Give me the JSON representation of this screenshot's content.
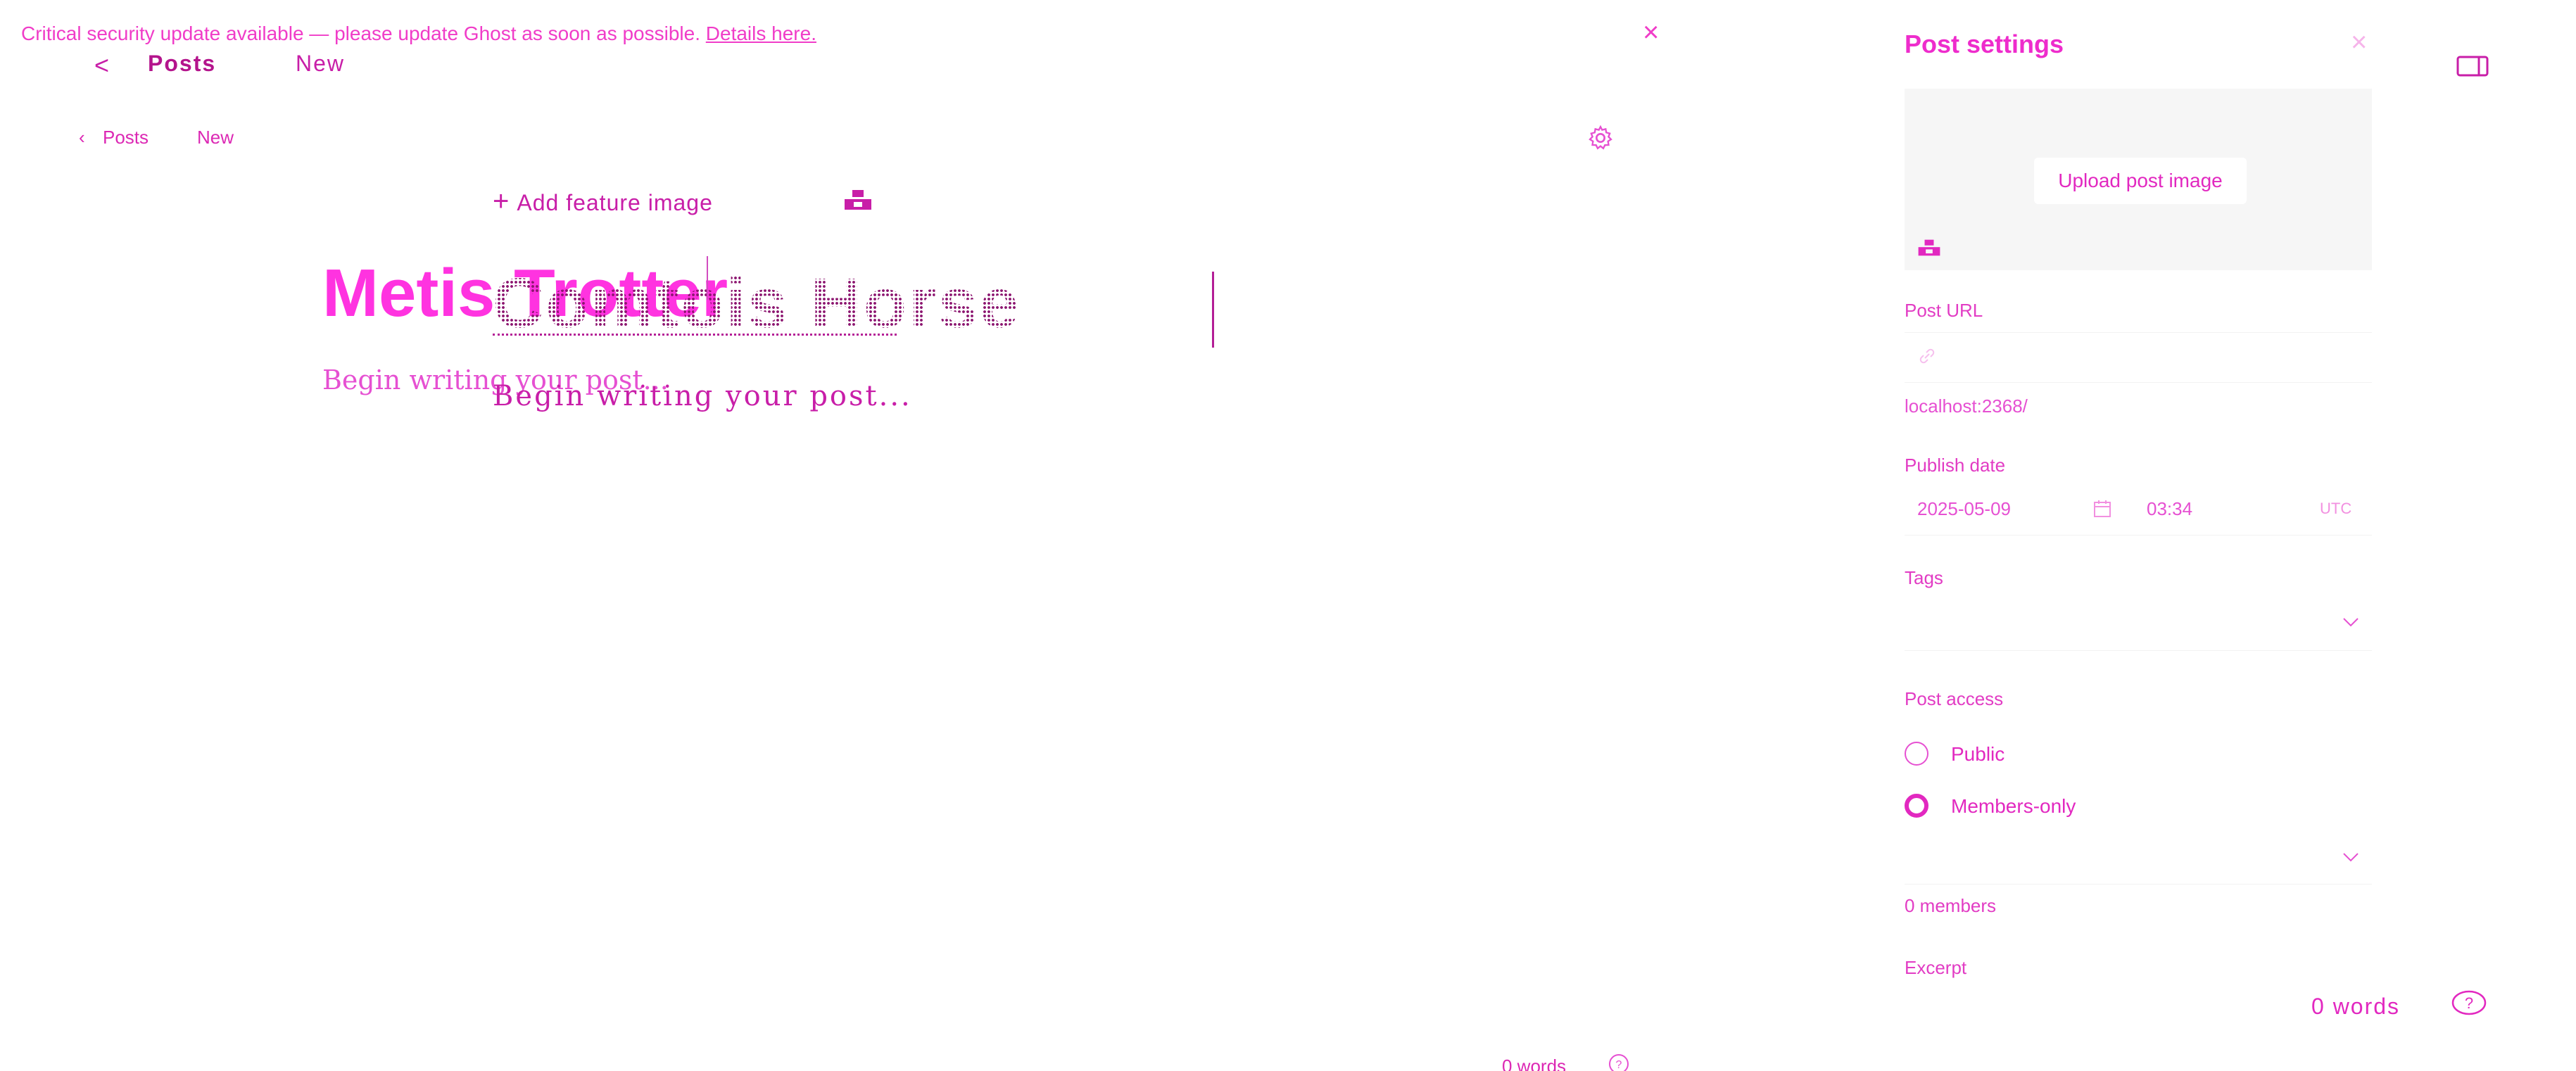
{
  "banner": {
    "message": "Critical security update available — please update Ghost as soon as possible.",
    "link_text": "Details here."
  },
  "topnav": {
    "back_glyph": "<",
    "posts": "Posts",
    "status": "New"
  },
  "subnav": {
    "back_glyph": "‹",
    "posts": "Posts",
    "status": "New"
  },
  "editor": {
    "add_feature_image": "Add feature image",
    "title_ghost": "Metis Trotter",
    "title": "Comtois Horse",
    "body_placeholder_ghost": "Begin writing your post...",
    "body_placeholder": "Begin writing your post...",
    "word_count_bottom": "0 words"
  },
  "settings": {
    "title": "Post settings",
    "close_glyph": "×",
    "upload_post_image": "Upload post image",
    "post_url_label": "Post URL",
    "post_url_value": "",
    "post_url_hint": "localhost:2368/",
    "publish_date_label": "Publish date",
    "publish_date": "2025-05-09",
    "publish_time": "03:34",
    "timezone": "UTC",
    "tags_label": "Tags",
    "post_access_label": "Post access",
    "access_options": [
      {
        "label": "Public",
        "selected": false
      },
      {
        "label": "Members-only",
        "selected": true
      }
    ],
    "members_count": "0 members",
    "excerpt_label": "Excerpt",
    "word_count": "0 words"
  },
  "icons": {
    "banner_close": "close-icon",
    "settings": "gear-icon",
    "unsplash": "unsplash-icon",
    "link": "link-icon",
    "calendar": "calendar-icon",
    "chevron": "chevron-down-icon",
    "help": "help-icon",
    "sidebar_toggle": "sidebar-toggle-icon"
  },
  "colors": {
    "accent": "#ff00ff",
    "dark_accent": "#8c1670",
    "panel_bg": "#f6f6f6"
  }
}
